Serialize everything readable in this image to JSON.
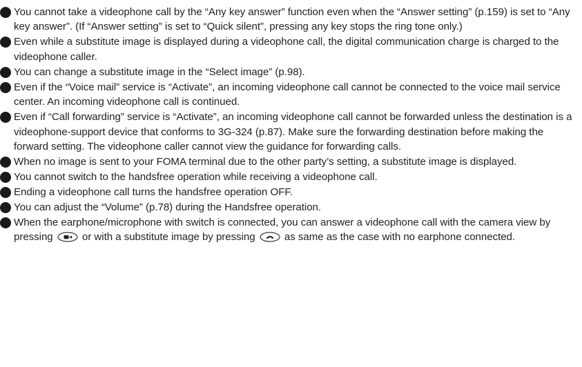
{
  "notes": [
    {
      "text": "You cannot take a videophone call by the “Any key answer” function even when the “Answer setting” (p.159) is set to “Any key answer”. (If “Answer setting” is set to “Quick silent”, pressing any key stops the ring tone only.)"
    },
    {
      "text": "Even while a substitute image is displayed during a videophone call, the digital communication charge is charged to the videophone caller."
    },
    {
      "text": "You can change a substitute image in the “Select image” (p.98)."
    },
    {
      "text": "Even if the “Voice mail” service is “Activate”, an incoming videophone call cannot be connected to the voice mail service center. An incoming videophone call is continued."
    },
    {
      "text": "Even if “Call forwarding” service is “Activate”, an incoming videophone call cannot be forwarded unless the destination is a videophone-support device that conforms to 3G-324 (p.87). Make sure the forwarding destination before making the forward setting. The videophone caller cannot view the guidance for forwarding calls."
    },
    {
      "text": "When no image is sent to your FOMA terminal due to the other party’s setting, a substitute image is displayed."
    },
    {
      "text": "You cannot switch to the handsfree operation while receiving a videophone call."
    },
    {
      "text": "Ending a videophone call turns the handsfree operation OFF."
    },
    {
      "text": "You can adjust the “Volume” (p.78) during the Handsfree operation."
    }
  ],
  "last_note": {
    "part1": "When the earphone/microphone with switch is connected, you can answer a videophone call with the camera view by pressing",
    "part2": "or with a substitute image by pressing",
    "part3": "as same as the case with no earphone connected."
  },
  "icons": {
    "camera_key": "camera-view-key-icon",
    "send_key": "send-key-icon"
  }
}
